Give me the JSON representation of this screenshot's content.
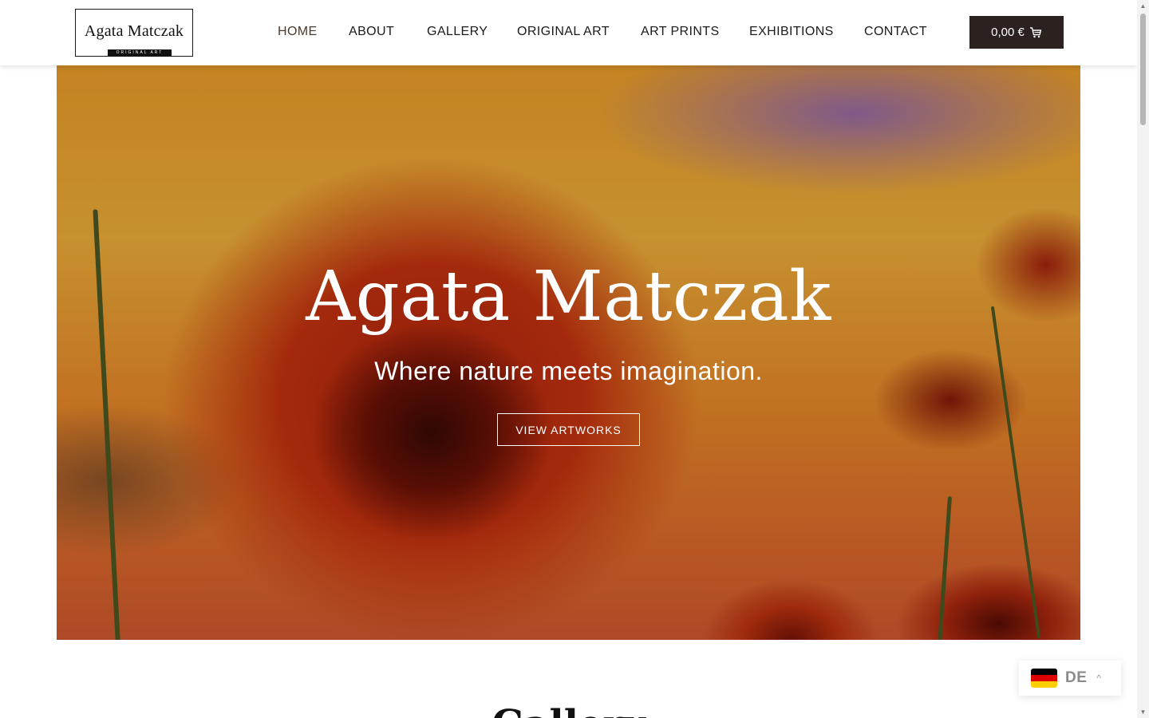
{
  "header": {
    "logo": {
      "name": "Agata Matczak",
      "subtitle": "ORIGINAL ART"
    },
    "nav": [
      {
        "label": "HOME",
        "active": true
      },
      {
        "label": "ABOUT"
      },
      {
        "label": "GALLERY"
      },
      {
        "label": "ORIGINAL ART"
      },
      {
        "label": "ART PRINTS"
      },
      {
        "label": "EXHIBITIONS"
      },
      {
        "label": "CONTACT"
      }
    ],
    "cart": {
      "amount": "0,00 €",
      "icon": "cart-icon"
    }
  },
  "hero": {
    "title": "Agata Matczak",
    "subtitle": "Where nature meets imagination.",
    "button_label": "VIEW ARTWORKS"
  },
  "section": {
    "heading": "Gallery"
  },
  "language_switcher": {
    "code": "DE",
    "flag_colors": [
      "#000000",
      "#dd0000",
      "#ffce00"
    ],
    "caret_icon": "chevron-up-icon"
  },
  "colors": {
    "accent_dark": "#2b2220",
    "active_nav": "#4a3a2e"
  }
}
